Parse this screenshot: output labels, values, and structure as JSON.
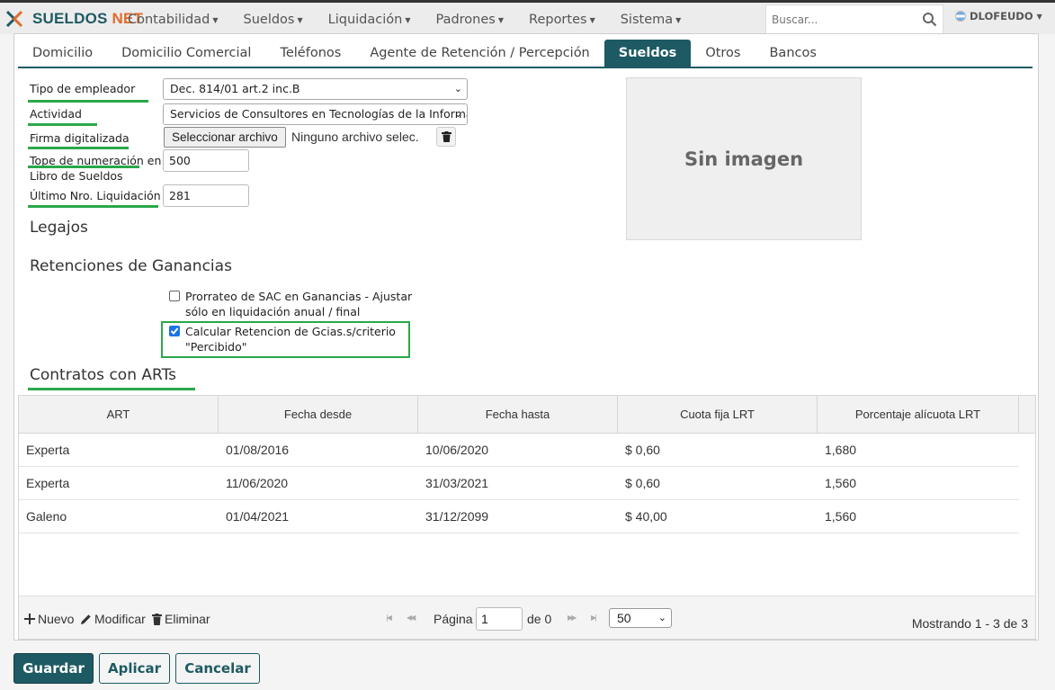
{
  "brand": {
    "part1": "SUELDOS",
    "part2": "NET"
  },
  "menu": [
    {
      "label": "Contabilidad"
    },
    {
      "label": "Sueldos"
    },
    {
      "label": "Liquidación"
    },
    {
      "label": "Padrones"
    },
    {
      "label": "Reportes"
    },
    {
      "label": "Sistema"
    }
  ],
  "search": {
    "placeholder": "Buscar..."
  },
  "user": {
    "name": "DLOFEUDO"
  },
  "tabs": [
    {
      "label": "Domicilio"
    },
    {
      "label": "Domicilio Comercial"
    },
    {
      "label": "Teléfonos"
    },
    {
      "label": "Agente de Retención / Percepción"
    },
    {
      "label": "Sueldos",
      "active": true
    },
    {
      "label": "Otros"
    },
    {
      "label": "Bancos"
    }
  ],
  "form": {
    "tipo_empleador": {
      "label": "Tipo de empleador",
      "value": "Dec. 814/01 art.2 inc.B"
    },
    "actividad": {
      "label": "Actividad",
      "value": "Servicios de Consultores en Tecnologías de la Información"
    },
    "firma": {
      "label": "Firma digitalizada",
      "button": "Seleccionar archivo",
      "status": "Ninguno archivo selec."
    },
    "tope": {
      "label_line1": "Tope de numeración en",
      "label_line2": "Libro de Sueldos",
      "value": "500"
    },
    "ultimo": {
      "label": "Último Nro. Liquidación",
      "value": "281"
    }
  },
  "image_placeholder": "Sin imagen",
  "sections": {
    "legajos": "Legajos",
    "retenciones": "Retenciones de Ganancias",
    "contratos": "Contratos con ARTs"
  },
  "checkboxes": [
    {
      "line1": "Prorrateo de SAC en Ganancias - Ajustar",
      "line2": "sólo en liquidación anual / final",
      "checked": false
    },
    {
      "line1": "Calcular Retencion de Gcias.s/criterio",
      "line2": "\"Percibido\"",
      "checked": true
    }
  ],
  "grid": {
    "columns": [
      "ART",
      "Fecha desde",
      "Fecha hasta",
      "Cuota fija LRT",
      "Porcentaje alícuota LRT"
    ],
    "rows": [
      [
        "Experta",
        "01/08/2016",
        "10/06/2020",
        "$ 0,60",
        "1,680"
      ],
      [
        "Experta",
        "11/06/2020",
        "31/03/2021",
        "$ 0,60",
        "1,560"
      ],
      [
        "Galeno",
        "01/04/2021",
        "31/12/2099",
        "$ 40,00",
        "1,560"
      ]
    ],
    "actions": {
      "new": "Nuevo",
      "edit": "Modificar",
      "delete": "Eliminar"
    },
    "pager": {
      "page_label": "Página",
      "page_value": "1",
      "of_label": "de 0",
      "page_size": "50"
    },
    "showing": "Mostrando 1 - 3 de 3"
  },
  "buttons": {
    "save": "Guardar",
    "apply": "Aplicar",
    "cancel": "Cancelar"
  },
  "colors": {
    "brand_primary": "#1e5a63",
    "brand_accent": "#e06b2c",
    "highlight": "#2aa84a"
  }
}
